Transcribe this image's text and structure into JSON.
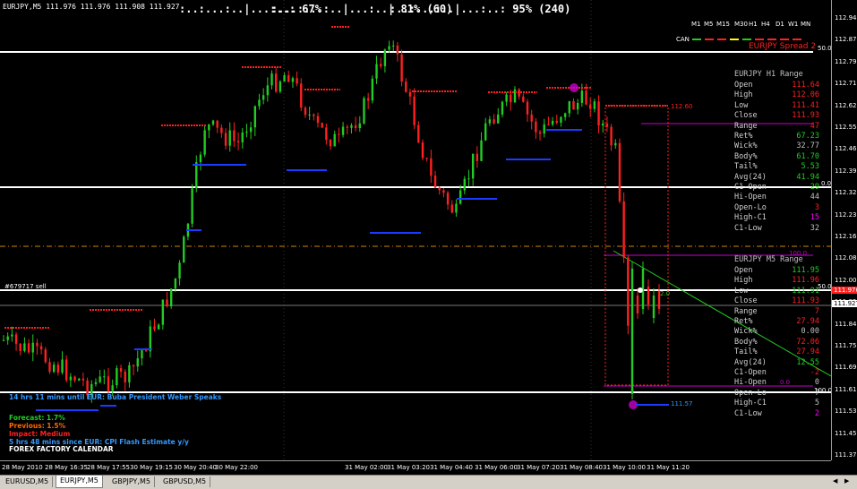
{
  "window": {
    "symbol_title": "EURJPY,M5",
    "ohlc": "111.976 111.976 111.908 111.927"
  },
  "meters": [
    {
      "bar": ":..:...:..|...:..:",
      "pct": "67%",
      "extra": ""
    },
    {
      "bar": ":...:...:..|...:..|",
      "pct": "81%",
      "extra": "(60)"
    },
    {
      "bar": ":..:...:..|...:..:",
      "pct": "95%",
      "extra": "(240)"
    }
  ],
  "timeframes": [
    "M1",
    "M5",
    "M15",
    "M30",
    "H1",
    "H4",
    "D1",
    "W1",
    "MN"
  ],
  "can_label": "CAN",
  "spread_label": "EURJPY Spread 2",
  "h1_panel": {
    "title": "EURJPY H1 Range",
    "rows": [
      {
        "label": "Open",
        "value": "111.64",
        "color": "#ff2020"
      },
      {
        "label": "High",
        "value": "112.06",
        "color": "#ff2020"
      },
      {
        "label": "Low",
        "value": "111.41",
        "color": "#ff2020"
      },
      {
        "label": "Close",
        "value": "111.93",
        "color": "#ff2020"
      },
      {
        "label": "Range",
        "value": "47",
        "color": "#ff2020"
      },
      {
        "label": "Ret%",
        "value": "67.23",
        "color": "#22cc22"
      },
      {
        "label": "Wick%",
        "value": "32.77",
        "color": "#c0c0c0"
      },
      {
        "label": "Body%",
        "value": "61.70",
        "color": "#22cc22"
      },
      {
        "label": "Tail%",
        "value": "5.53",
        "color": "#22cc22"
      },
      {
        "label": "Avg(24)",
        "value": "41.94",
        "color": "#22cc22"
      },
      {
        "label": "C1-Open",
        "value": "29",
        "color": "#22cc22"
      },
      {
        "label": "Hi-Open",
        "value": "44",
        "color": "#c0c0c0"
      },
      {
        "label": "Open-Lo",
        "value": "3",
        "color": "#ff2020"
      },
      {
        "label": "High-C1",
        "value": "15",
        "color": "#ff00ff"
      },
      {
        "label": "C1-Low",
        "value": "32",
        "color": "#c0c0c0"
      }
    ]
  },
  "m5_panel": {
    "title": "EURJPY M5 Range",
    "rows": [
      {
        "label": "Open",
        "value": "111.95",
        "color": "#22cc22"
      },
      {
        "label": "High",
        "value": "111.96",
        "color": "#ff2020"
      },
      {
        "label": "Low",
        "value": "111.91",
        "color": "#22cc22"
      },
      {
        "label": "Close",
        "value": "111.93",
        "color": "#ff2020"
      },
      {
        "label": "Range",
        "value": "7",
        "color": "#ff2020"
      },
      {
        "label": "Ret%",
        "value": "27.94",
        "color": "#ff2020"
      },
      {
        "label": "Wick%",
        "value": "0.00",
        "color": "#c0c0c0"
      },
      {
        "label": "Body%",
        "value": "72.06",
        "color": "#ff2020"
      },
      {
        "label": "Tail%",
        "value": "27.94",
        "color": "#ff2020"
      },
      {
        "label": "Avg(24)",
        "value": "12.55",
        "color": "#22cc22"
      },
      {
        "label": "C1-Open",
        "value": "-2",
        "color": "#ff2020"
      },
      {
        "label": "Hi-Open",
        "value": "0",
        "color": "#c0c0c0"
      },
      {
        "label": "Open-Lo",
        "value": "7",
        "color": "#c0c0c0"
      },
      {
        "label": "High-C1",
        "value": "5",
        "color": "#c0c0c0"
      },
      {
        "label": "C1-Low",
        "value": "2",
        "color": "#ff00ff"
      }
    ]
  },
  "news": [
    {
      "text": "14 hrs 11 mins until EUR: Buba President Weber Speaks",
      "color": "#3399ff"
    },
    {
      "text": "Forecast: 1.7%",
      "color": "#22cc22"
    },
    {
      "text": "Previous: 1.5%",
      "color": "#ff6600"
    },
    {
      "text": "Impact: Medium",
      "color": "#ff2020"
    },
    {
      "text": "5 hrs 48 mins since EUR: CPI Flash Estimate y/y",
      "color": "#3399ff"
    },
    {
      "text": "FOREX FACTORY CALENDAR",
      "color": "#ffffff"
    }
  ],
  "chart_labels": {
    "sell_order": "#679717 sell",
    "level_50_top": "50.0",
    "level_0_mid": "0.0",
    "level_50_m5": "50.0",
    "level_50_right": "50.0",
    "level_100_fib": "100.0",
    "level_0_fib": "0.0",
    "level_100_bottom": "100.0",
    "tag_top": "112.60",
    "tag_bottom": "111.57",
    "small_2": "2.0"
  },
  "price_axis": [
    "112.945",
    "112.870",
    "112.795",
    "112.710",
    "112.625",
    "112.550",
    "112.465",
    "112.395",
    "112.320",
    "112.235",
    "112.160",
    "112.080",
    "112.000",
    "111.920",
    "111.840",
    "111.755",
    "111.690",
    "111.610",
    "111.535",
    "111.450",
    "111.375"
  ],
  "current_price": "111.927",
  "current_price_red": "111.976",
  "time_axis": [
    "28 May 2010",
    "28 May 16:35",
    "28 May 17:55",
    "30 May 19:15",
    "30 May 20:40",
    "30 May 22:00",
    "31 May 02:00",
    "31 May 03:20",
    "31 May 04:40",
    "31 May 06:00",
    "31 May 07:20",
    "31 May 08:40",
    "31 May 10:00",
    "31 May 11:20"
  ],
  "tabs": [
    "EURUSD,M5",
    "EURJPY,M5",
    "GBPJPY,M5",
    "GBPUSD,M5"
  ],
  "active_tab": 1,
  "colors": {
    "bull": "#22cc22",
    "bear": "#ff2020",
    "support": "#1a3cff",
    "resistance": "#ff2020",
    "level": "#ffffff",
    "magenta": "#cc00cc"
  }
}
